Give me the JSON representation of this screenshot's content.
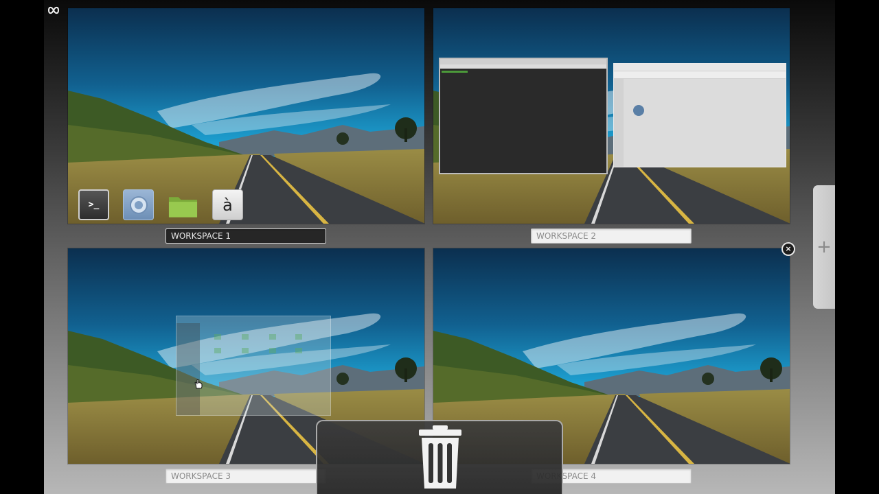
{
  "workspaces": [
    {
      "label": "WORKSPACE 1",
      "active": true
    },
    {
      "label": "WORKSPACE 2",
      "active": false
    },
    {
      "label": "WORKSPACE 3",
      "active": false
    },
    {
      "label": "WORKSPACE 4",
      "active": false
    }
  ],
  "dock": {
    "items": [
      {
        "icon": "terminal-icon",
        "glyph": ">_"
      },
      {
        "icon": "browser-icon"
      },
      {
        "icon": "folder-icon"
      },
      {
        "icon": "character-map-icon",
        "glyph": "à"
      }
    ]
  },
  "buttons": {
    "add_workspace": "+",
    "close_workspace": "×"
  },
  "icons": {
    "top_left": "link-icon",
    "trash": "trash-icon",
    "cursor": "hand-cursor-icon"
  },
  "colors": {
    "active_label_bg": "#262626",
    "inactive_label_bg": "#f1f1f1",
    "sky_top": "#0b2f4f",
    "sky_bright": "#1ea5d6"
  }
}
